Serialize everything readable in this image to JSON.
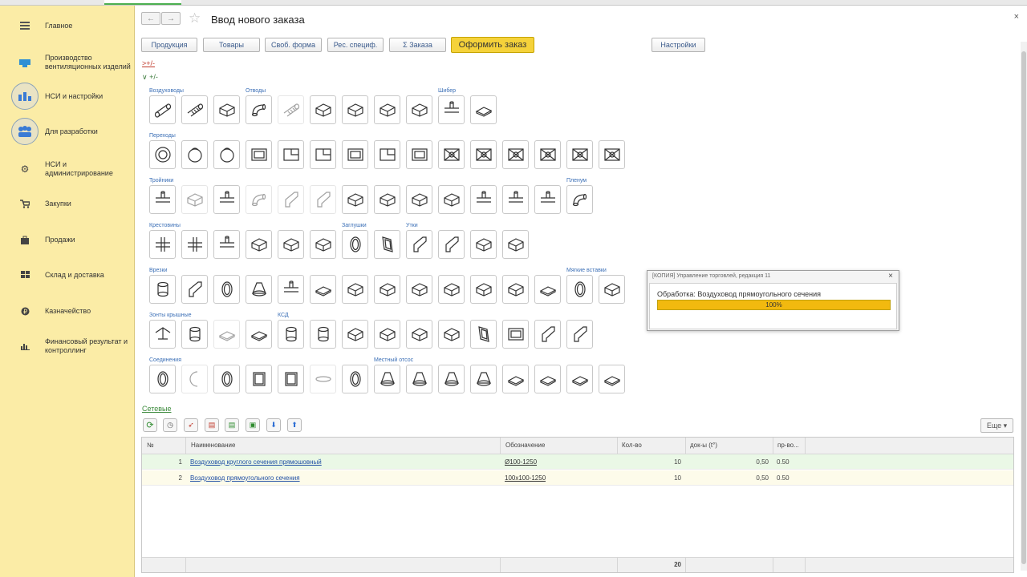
{
  "sidebar": {
    "items": [
      {
        "label": "Главное",
        "icon": "hamburger-menu-icon"
      },
      {
        "label": "Производство вентиляционных изделий",
        "icon": "factory-icon"
      },
      {
        "label": "НСИ и настройки",
        "icon": "settings-badge-icon"
      },
      {
        "label": "Для разработки",
        "icon": "team-badge-icon"
      },
      {
        "label": "НСИ и администрирование",
        "icon": "gear-icon"
      },
      {
        "label": "Закупки",
        "icon": "cart-icon"
      },
      {
        "label": "Продажи",
        "icon": "bag-icon"
      },
      {
        "label": "Склад и доставка",
        "icon": "warehouse-grid-icon"
      },
      {
        "label": "Казначейство",
        "icon": "coin-icon"
      },
      {
        "label": "Финансовый результат и контроллинг",
        "icon": "bar-chart-icon"
      }
    ]
  },
  "header": {
    "title": "Ввод нового заказа",
    "back_icon": "←",
    "forward_icon": "→",
    "star_icon": "☆",
    "close_icon": "×"
  },
  "toolbar": {
    "products": "Продукция",
    "goods": "Товары",
    "free_form": "Своб. форма",
    "res_spec": "Рес. специф.",
    "order_sum": "Σ Заказа",
    "place_order": "Оформить заказ",
    "settings": "Настройки"
  },
  "links": {
    "plus_minus_red": ">+/-",
    "plus_minus_toggle": "∨ +/-",
    "network": "Сетевые"
  },
  "catalog_groups": {
    "ducts": "Воздуховоды",
    "bends": "Отводы",
    "gate": "Шибер",
    "transitions": "Переходы",
    "tees": "Тройники",
    "plenum": "Пленум",
    "crosses": "Крестовины",
    "plugs": "Заглушки",
    "offsets": "Утки",
    "taps": "Врезки",
    "soft_inserts": "Мягкие вставки",
    "roof_hoods": "Зонты крышные",
    "ksd": "КСД",
    "connections": "Соединения",
    "local_exhaust": "Местный отсос"
  },
  "grid": {
    "more_label": "Еще ▾",
    "columns": [
      "№",
      "Наименование",
      "Обозначение",
      "Кол-во",
      "док-ы (t°)",
      "пр-во..."
    ],
    "rows": [
      {
        "num": "1",
        "name": "Воздуховод круглого сечения прямошовный",
        "code": "Ø100-1250",
        "qty": "10",
        "doc": "0,50",
        "prod": "0.50"
      },
      {
        "num": "2",
        "name": "Воздуховод прямоугольного сечения",
        "code": "100x100-1250",
        "qty": "10",
        "doc": "0,50",
        "prod": "0.50"
      }
    ],
    "footer_qty": "20"
  },
  "dialog": {
    "title": "[КОПИЯ] Управление торговлей, редакция 11",
    "text": "Обработка: Воздуховод прямоугольного сечения",
    "progress": 1.0,
    "progress_label": "100%",
    "close_icon": "×"
  },
  "colors": {
    "sidebar_bg": "#fbeca6",
    "accent_yellow": "#f5d23a",
    "progress_fill": "#f2b90f",
    "link_blue": "#2150a5"
  }
}
